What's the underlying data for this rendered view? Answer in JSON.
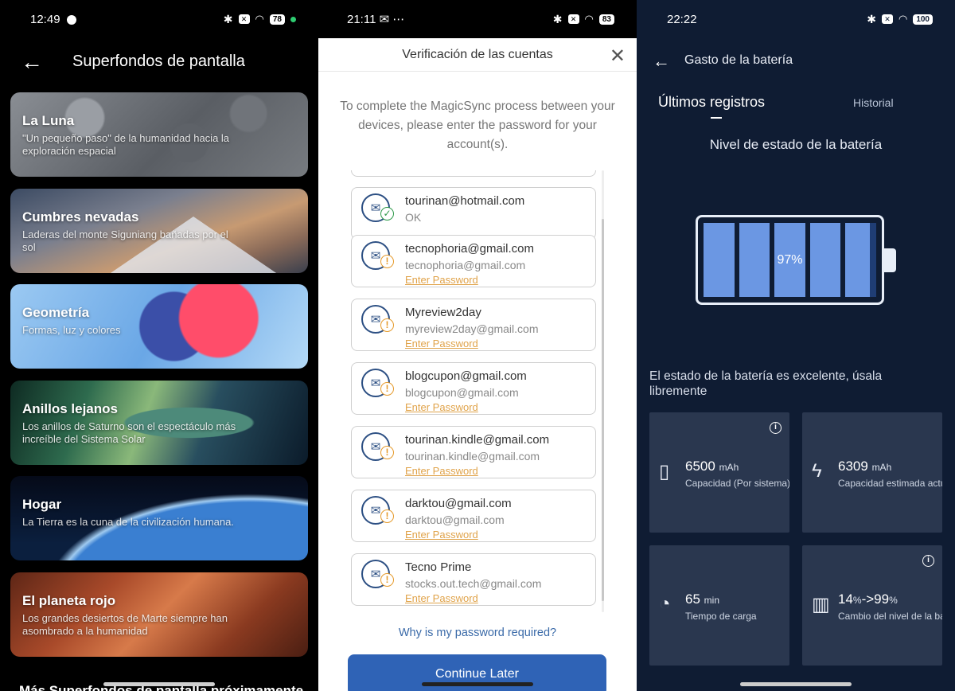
{
  "wallpapers": {
    "status": {
      "time": "12:49",
      "battery": "78"
    },
    "title": "Superfondos de pantalla",
    "items": [
      {
        "title": "La Luna",
        "subtitle": "\"Un pequeño paso\" de la humanidad hacia la exploración espacial"
      },
      {
        "title": "Cumbres nevadas",
        "subtitle": "Laderas del monte Siguniang bañadas por el sol"
      },
      {
        "title": "Geometría",
        "subtitle": "Formas, luz y colores"
      },
      {
        "title": "Anillos lejanos",
        "subtitle": "Los anillos de Saturno son el espectáculo más increíble del Sistema Solar"
      },
      {
        "title": "Hogar",
        "subtitle": "La Tierra es la cuna de la civilización humana."
      },
      {
        "title": "El planeta rojo",
        "subtitle": "Los grandes desiertos de Marte siempre han asombrado a la humanidad"
      }
    ],
    "more": "Más Superfondos de pantalla próximamente"
  },
  "verification": {
    "status": {
      "time": "21:11",
      "battery": "83"
    },
    "title": "Verificación de las cuentas",
    "intro": "To complete the MagicSync process between your devices, please enter the password for your account(s).",
    "accounts": [
      {
        "name": "tourinan@hotmail.com",
        "detail": "OK",
        "state": "ok"
      },
      {
        "name": "tecnophoria@gmail.com",
        "detail": "tecnophoria@gmail.com",
        "action": "Enter Password",
        "state": "warn"
      },
      {
        "name": "Myreview2day",
        "detail": "myreview2day@gmail.com",
        "action": "Enter Password",
        "state": "warn"
      },
      {
        "name": "blogcupon@gmail.com",
        "detail": "blogcupon@gmail.com",
        "action": "Enter Password",
        "state": "warn"
      },
      {
        "name": "tourinan.kindle@gmail.com",
        "detail": "tourinan.kindle@gmail.com",
        "action": "Enter Password",
        "state": "warn"
      },
      {
        "name": "darktou@gmail.com",
        "detail": "darktou@gmail.com",
        "action": "Enter Password",
        "state": "warn"
      },
      {
        "name": "Tecno Prime",
        "detail": "stocks.out.tech@gmail.com",
        "action": "Enter Password",
        "state": "warn"
      }
    ],
    "why": "Why is my password required?",
    "continue": "Continue Later"
  },
  "battery": {
    "status": {
      "time": "22:22",
      "battery": "100"
    },
    "title": "Gasto de la batería",
    "tabs": {
      "recent": "Últimos registros",
      "history": "Historial"
    },
    "section": "Nivel de estado de la batería",
    "level_percent": 97,
    "level_label": "97%",
    "health_text": "El estado de la batería es excelente, úsala libremente",
    "cards": [
      {
        "value": "6500",
        "unit": "mAh",
        "label": "Capacidad (Por sistema)",
        "icon": "battery-list-icon"
      },
      {
        "value": "6309",
        "unit": "mAh",
        "label": "Capacidad estimada actual",
        "icon": "lightning-icon"
      },
      {
        "value": "65",
        "unit": "min",
        "label": "Tiempo de carga",
        "icon": "speedometer-icon"
      },
      {
        "value": "14",
        "unit1": "%",
        "mid": "->99",
        "unit2": "%",
        "label": "Cambio del nivel de la batería",
        "icon": "bar-chart-icon"
      }
    ]
  }
}
